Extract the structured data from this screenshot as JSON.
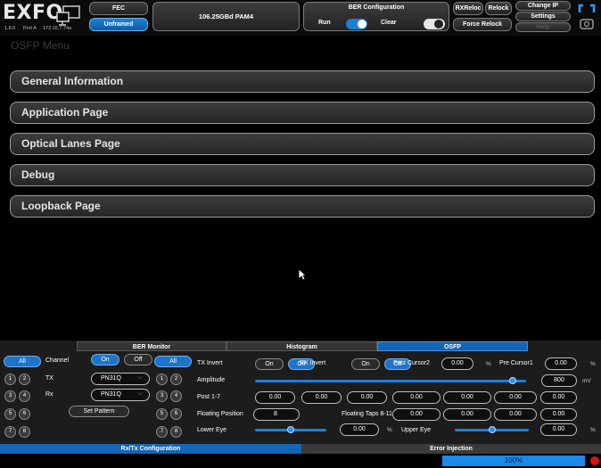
{
  "header": {
    "logo": "EXFO",
    "version": "1.8.0",
    "port": "Port A",
    "ip": "172.16.7.74a",
    "fec_label": "FEC",
    "framing_label": "Unframed",
    "rate_label": "106.25GBd PAM4",
    "ber_config_label": "BER Configuration",
    "run_label": "Run",
    "clear_label": "Clear",
    "rxreloc_label": "RXReloc",
    "relock_label": "Relock",
    "force_relock_label": "Force Relock",
    "change_ip_label": "Change IP",
    "settings_label": "Settings",
    "help_label": "Help"
  },
  "menu": {
    "title": "OSFP Menu",
    "items": [
      {
        "label": "General Information"
      },
      {
        "label": "Application Page"
      },
      {
        "label": "Optical Lanes Page"
      },
      {
        "label": "Debug"
      },
      {
        "label": "Loopback Page"
      }
    ]
  },
  "bottom_tabs": {
    "ber_monitor": "BER Monitor",
    "histogram": "Histogram",
    "osfp": "OSFP"
  },
  "left_config": {
    "all_label": "All",
    "channel_label": "Channel",
    "on_label": "On",
    "off_label": "Off",
    "tx_label": "TX",
    "rx_label": "Rx",
    "tx_pattern": "PN31Q",
    "rx_pattern": "PN31Q",
    "set_pattern_label": "Set Pattern",
    "lanes": [
      "1",
      "2",
      "3",
      "4",
      "5",
      "6",
      "7",
      "8"
    ]
  },
  "right_config": {
    "all_label": "All",
    "lanes": [
      "1",
      "2",
      "3",
      "4",
      "5",
      "6",
      "7",
      "8"
    ],
    "tx_invert_label": "TX Invert",
    "tx_invert_on": "On",
    "tx_invert_off": "Off",
    "rx_invert_label": "RX Invert",
    "rx_invert_on": "On",
    "rx_invert_off": "Off",
    "post_cursor2_label": "Post Cursor2",
    "post_cursor2_value": "0.00",
    "percent": "%",
    "pre_cursor1_label": "Pre Cursor1",
    "pre_cursor1_value": "0.00",
    "amplitude_label": "Amplitude",
    "amplitude_value": "800",
    "amplitude_unit": "mV",
    "amplitude_level": 0.95,
    "post_label": "Post 1-7",
    "post_values": [
      "0.00",
      "0.00",
      "0.00",
      "0.00",
      "0.00",
      "0.00",
      "0.00"
    ],
    "floating_position_label": "Floating Position",
    "floating_position_value": "8",
    "floating_taps_label": "Floating Taps 8-11",
    "floating_taps_values": [
      "0.00",
      "0.00",
      "0.00",
      "0.00"
    ],
    "lower_eye_label": "Lower Eye",
    "lower_eye_value": "0.00",
    "lower_eye_level": 0.5,
    "upper_eye_label": "Upper Eye",
    "upper_eye_value": "0.00",
    "upper_eye_level": 0.5
  },
  "footer": {
    "rxtx_label": "Rx/Tx Configuration",
    "error_injection_label": "Error Injection",
    "progress_text": "100%",
    "progress_value": 1.0
  }
}
